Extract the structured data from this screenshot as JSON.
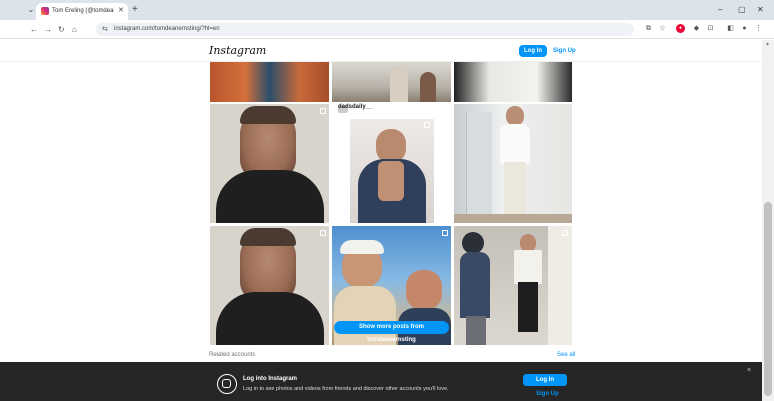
{
  "browser": {
    "tab_title": "Tom Ereling (@tomdeanernsting)",
    "url": "instagram.com/tomdeanernsting/?hl=en",
    "icons": [
      "menu-icon",
      "close-icon",
      "new-tab-icon",
      "minimize-icon",
      "maximize-icon",
      "window-close-icon",
      "back-icon",
      "forward-icon",
      "reload-icon",
      "home-icon",
      "site-info-icon",
      "install-icon",
      "star-icon",
      "extension-icon",
      "profile-icon"
    ],
    "new_tab": "+",
    "minimize": "–",
    "maximize": "▢",
    "close": "✕"
  },
  "header": {
    "logo": "Instagram",
    "login_label": "Log In",
    "signup_label": "Sign Up"
  },
  "grid": {
    "popup_username": "dadsdaily__",
    "show_more_label": "Show more posts from tomdeanernsting"
  },
  "related": {
    "label": "Related accounts",
    "see_all": "See all"
  },
  "banner": {
    "title": "Log into Instagram",
    "subtitle": "Log in to see photos and videos from friends and discover other accounts you'll love.",
    "login_label": "Log In",
    "signup_label": "Sign Up",
    "close_glyph": "×"
  },
  "colors": {
    "accent": "#0095f6",
    "banner_bg": "#262626"
  }
}
